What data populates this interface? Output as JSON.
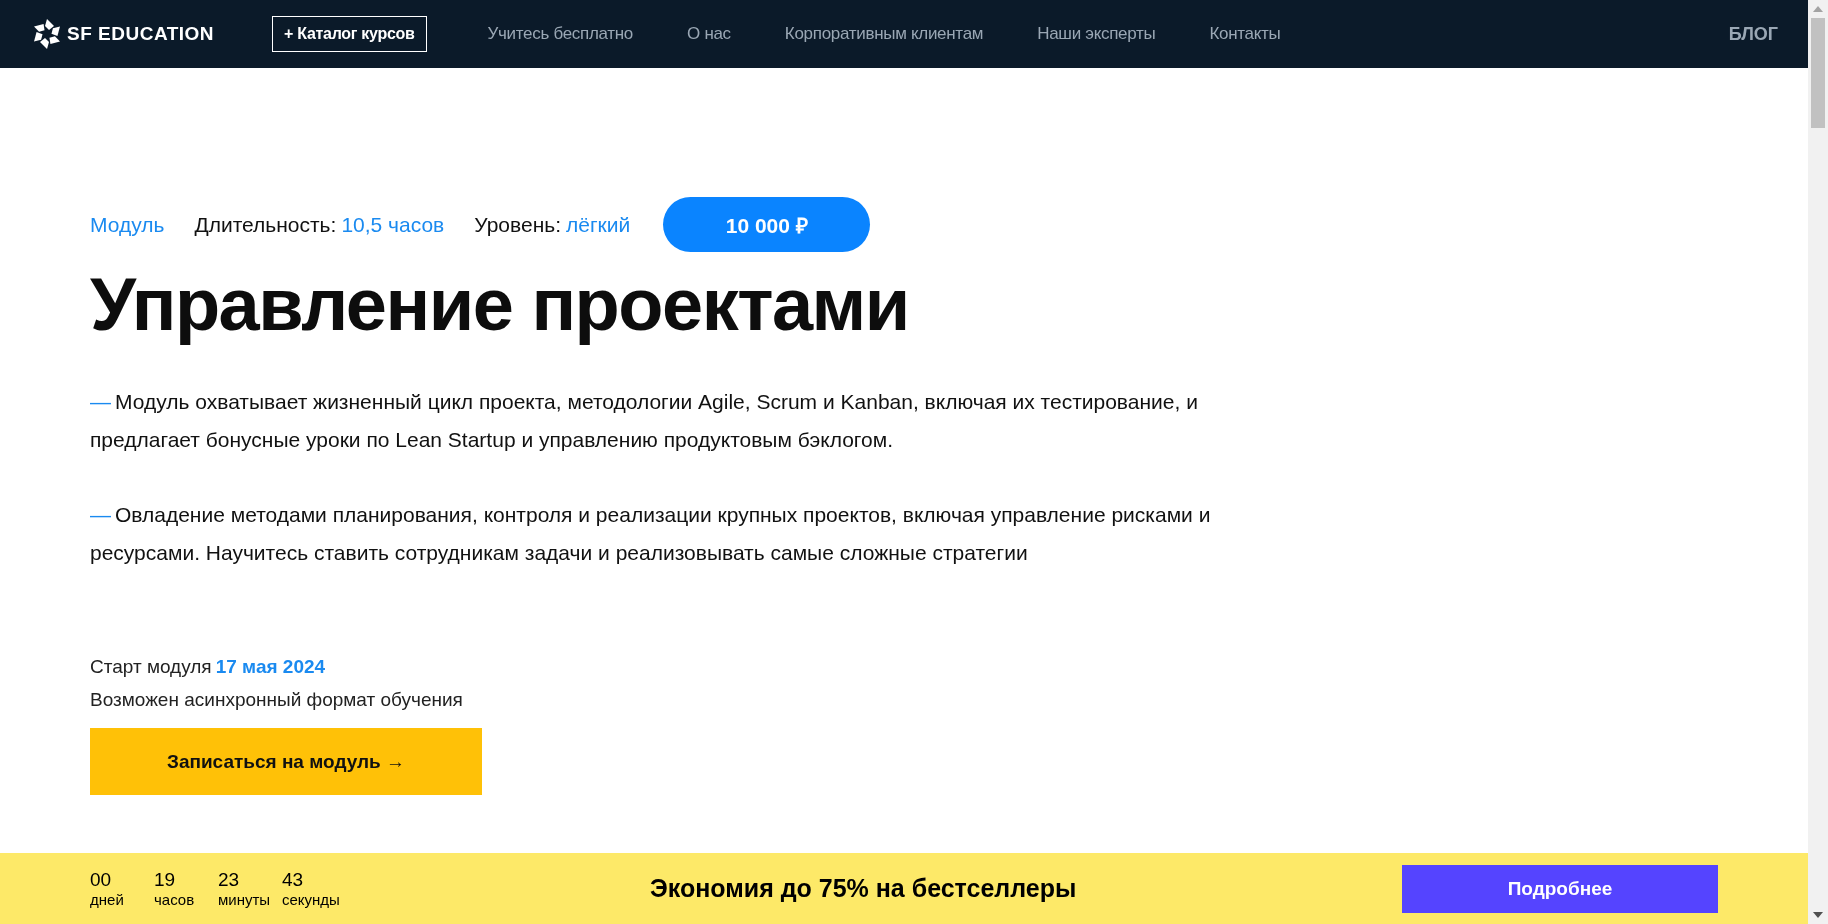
{
  "header": {
    "logo": "SF EDUCATION",
    "catalog_button": "+ Каталог курсов",
    "nav": [
      "Учитесь бесплатно",
      "О нас",
      "Корпоративным клиентам",
      "Наши эксперты",
      "Контакты"
    ],
    "blog": "БЛОГ"
  },
  "meta": {
    "type": "Модуль",
    "duration_label": "Длительность:",
    "duration": "10,5 часов",
    "level_label": "Уровень:",
    "level": "лёгкий",
    "price": "10 000 ₽"
  },
  "title": "Управление проектами",
  "paragraphs": [
    {
      "dash": "—",
      "text": "Модуль охватывает жизненный цикл проекта, методологии Agile, Scrum и Kanban, включая их тестирование, и предлагает бонусные уроки по Lean Startup и управлению продуктовым бэклогом."
    },
    {
      "dash": "—",
      "text": "Овладение методами планирования, контроля и реализации крупных проектов, включая управление рисками и ресурсами. Научитесь ставить сотрудникам задачи и реализовывать самые сложные стратегии"
    }
  ],
  "start": {
    "label": "Старт модуля",
    "date": "17 мая 2024",
    "note": "Возможен асинхронный формат обучения"
  },
  "enroll_button": "Записаться на модуль →",
  "promo": {
    "timer": [
      {
        "value": "00",
        "unit": "дней"
      },
      {
        "value": "19",
        "unit": "часов"
      },
      {
        "value": "23",
        "unit": "минуты"
      },
      {
        "value": "43",
        "unit": "секунды"
      }
    ],
    "text": "Экономия до 75% на бестселлеры",
    "button": "Подробнее"
  }
}
